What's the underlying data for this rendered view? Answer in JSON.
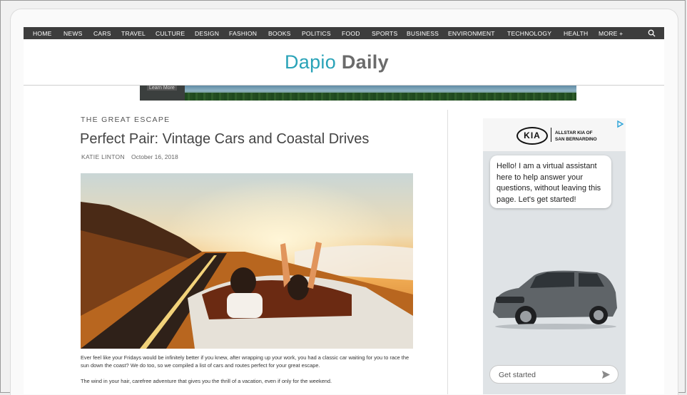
{
  "nav": {
    "items": [
      "HOME",
      "NEWS",
      "CARS",
      "TRAVEL",
      "CULTURE",
      "DESIGN",
      "FASHION",
      "BOOKS",
      "POLITICS",
      "FOOD",
      "SPORTS",
      "BUSINESS",
      "ENVIRONMENT",
      "TECHNOLOGY",
      "HEALTH",
      "MORE +"
    ]
  },
  "header": {
    "logo_part1": "Dapio",
    "logo_part2": "Daily"
  },
  "banner": {
    "button_label": "Learn More"
  },
  "article": {
    "kicker": "THE GREAT ESCAPE",
    "title": "Perfect Pair: Vintage Cars and Coastal Drives",
    "author": "KATIE LINTON",
    "date": "October 16, 2018",
    "paragraph1": "Ever feel like your Fridays would be infinitely better if you knew, after wrapping up your work, you had a classic car waiting for you to race the sun down the coast? We do too, so we compiled a list of cars and routes perfect for your great escape.",
    "paragraph2": "The wind in your hair, carefree adventure that gives you the thrill of a vacation, even if only for the weekend."
  },
  "ad": {
    "brand": "KIA",
    "dealer_line1": "ALLSTAR KIA OF",
    "dealer_line2": "SAN BERNARDINO",
    "message": "Hello! I am a virtual assistant here to help answer your questions, without leaving this page. Let's get started!",
    "input_placeholder": "Get started"
  },
  "colors": {
    "nav_bg": "#3d3d3d",
    "logo_accent": "#2aa3b8",
    "logo_gray": "#6b6b6b"
  }
}
